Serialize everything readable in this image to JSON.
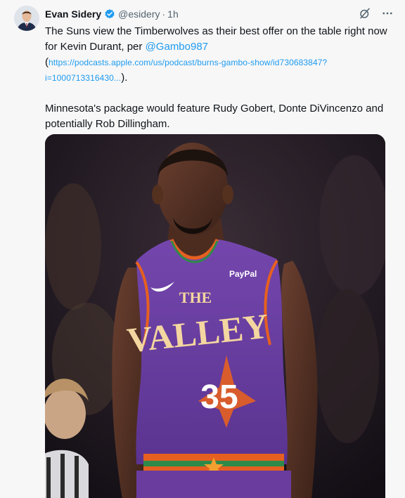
{
  "tweet": {
    "author_name": "Evan Sidery",
    "handle": "@esidery",
    "separator": "·",
    "time": "1h",
    "text_line1": "The Suns view the Timberwolves as their best offer on the table right now for Kevin Durant, per ",
    "mention": "@Gambo987",
    "paren_open": "(",
    "link": "https://podcasts.apple.com/us/podcast/burns-gambo-show/id730683847?i=1000713316430...",
    "paren_close": ").",
    "paragraph2": "Minnesota's package would feature Rudy Gobert, Donte DiVincenzo and potentially Rob Dillingham."
  },
  "icons": {
    "verified": "verified-badge-icon",
    "grok": "grok-icon",
    "more": "more-options-icon"
  },
  "media": {
    "jersey_logo": "PayPal",
    "jersey_text_top": "THE",
    "jersey_text_main": "VALLEY",
    "jersey_number": "35"
  },
  "colors": {
    "link": "#1d9bf0",
    "text": "#0f1419",
    "muted": "#536471",
    "jersey_purple": "#6b3fa0",
    "jersey_orange": "#e56020"
  }
}
